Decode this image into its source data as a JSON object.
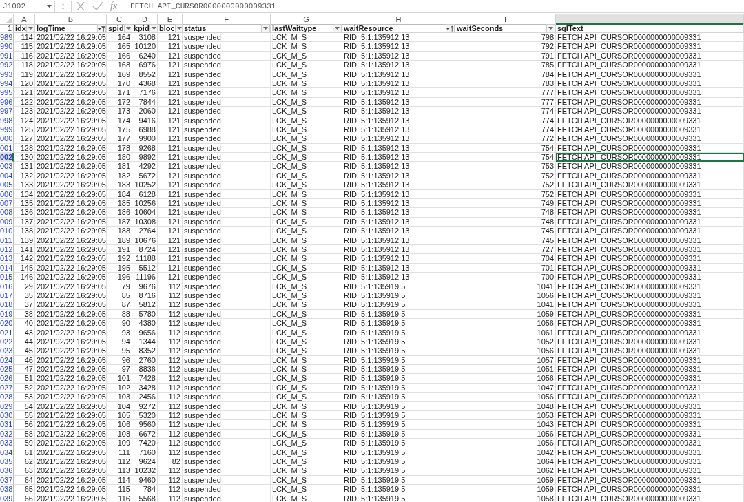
{
  "formula_bar": {
    "name_box": "J1002",
    "function_label": "fx",
    "formula": "FETCH API_CURSOR0000000000009331"
  },
  "column_letters": [
    {
      "letter": "A",
      "selected": false
    },
    {
      "letter": "B",
      "selected": false
    },
    {
      "letter": "C",
      "selected": false
    },
    {
      "letter": "D",
      "selected": false
    },
    {
      "letter": "E",
      "selected": false
    },
    {
      "letter": "F",
      "selected": false
    },
    {
      "letter": "G",
      "selected": false
    },
    {
      "letter": "H",
      "selected": false
    },
    {
      "letter": "I",
      "selected": false
    },
    {
      "selected": true
    }
  ],
  "header_row": {
    "num": "1",
    "columns": [
      {
        "label": "idx",
        "kind": "dropdown",
        "numeric": true
      },
      {
        "label": "logTime",
        "kind": "filtered"
      },
      {
        "label": "spid",
        "kind": "dropdown",
        "numeric": true
      },
      {
        "label": "kpid",
        "kind": "dropdown",
        "numeric": true
      },
      {
        "label": "bloc",
        "kind": "dropdown",
        "numeric": true
      },
      {
        "label": "status",
        "kind": "dropdown",
        "numeric": false
      },
      {
        "label": "lastWaittype",
        "kind": "dropdown",
        "numeric": false
      },
      {
        "label": "waitResource",
        "kind": "sorted",
        "numeric": false
      },
      {
        "label": "waitSeconds",
        "kind": "dropdown",
        "numeric": true
      },
      {
        "label": "sqlText",
        "numeric": false
      }
    ]
  },
  "rows": [
    {
      "num": "989",
      "selected": false,
      "cells": [
        "114",
        "2021/02/22 16:29:05",
        "164",
        "3108",
        "121",
        "suspended",
        "LCK_M_S",
        "RID: 5:1:135912:13",
        "798",
        "FETCH API_CURSOR0000000000009331"
      ]
    },
    {
      "num": "990",
      "selected": false,
      "cells": [
        "115",
        "2021/02/22 16:29:05",
        "165",
        "10120",
        "121",
        "suspended",
        "LCK_M_S",
        "RID: 5:1:135912:13",
        "792",
        "FETCH API_CURSOR0000000000009331"
      ]
    },
    {
      "num": "991",
      "selected": false,
      "cells": [
        "116",
        "2021/02/22 16:29:05",
        "166",
        "6240",
        "121",
        "suspended",
        "LCK_M_S",
        "RID: 5:1:135912:13",
        "791",
        "FETCH API_CURSOR0000000000009331"
      ]
    },
    {
      "num": "992",
      "selected": false,
      "cells": [
        "118",
        "2021/02/22 16:29:05",
        "168",
        "6976",
        "121",
        "suspended",
        "LCK_M_S",
        "RID: 5:1:135912:13",
        "785",
        "FETCH API_CURSOR0000000000009331"
      ]
    },
    {
      "num": "993",
      "selected": false,
      "cells": [
        "119",
        "2021/02/22 16:29:05",
        "169",
        "8552",
        "121",
        "suspended",
        "LCK_M_S",
        "RID: 5:1:135912:13",
        "784",
        "FETCH API_CURSOR0000000000009331"
      ]
    },
    {
      "num": "994",
      "selected": false,
      "cells": [
        "120",
        "2021/02/22 16:29:05",
        "170",
        "4368",
        "121",
        "suspended",
        "LCK_M_S",
        "RID: 5:1:135912:13",
        "783",
        "FETCH API_CURSOR0000000000009331"
      ]
    },
    {
      "num": "995",
      "selected": false,
      "cells": [
        "121",
        "2021/02/22 16:29:05",
        "171",
        "7176",
        "121",
        "suspended",
        "LCK_M_S",
        "RID: 5:1:135912:13",
        "777",
        "FETCH API_CURSOR0000000000009331"
      ]
    },
    {
      "num": "996",
      "selected": false,
      "cells": [
        "122",
        "2021/02/22 16:29:05",
        "172",
        "7844",
        "121",
        "suspended",
        "LCK_M_S",
        "RID: 5:1:135912:13",
        "777",
        "FETCH API_CURSOR0000000000009331"
      ]
    },
    {
      "num": "997",
      "selected": false,
      "cells": [
        "123",
        "2021/02/22 16:29:05",
        "173",
        "2060",
        "121",
        "suspended",
        "LCK_M_S",
        "RID: 5:1:135912:13",
        "774",
        "FETCH API_CURSOR0000000000009331"
      ]
    },
    {
      "num": "998",
      "selected": false,
      "cells": [
        "124",
        "2021/02/22 16:29:05",
        "174",
        "9416",
        "121",
        "suspended",
        "LCK_M_S",
        "RID: 5:1:135912:13",
        "774",
        "FETCH API_CURSOR0000000000009331"
      ]
    },
    {
      "num": "999",
      "selected": false,
      "cells": [
        "125",
        "2021/02/22 16:29:05",
        "175",
        "6988",
        "121",
        "suspended",
        "LCK_M_S",
        "RID: 5:1:135912:13",
        "774",
        "FETCH API_CURSOR0000000000009331"
      ]
    },
    {
      "num": "000",
      "selected": false,
      "cells": [
        "127",
        "2021/02/22 16:29:05",
        "177",
        "9900",
        "121",
        "suspended",
        "LCK_M_S",
        "RID: 5:1:135912:13",
        "772",
        "FETCH API_CURSOR0000000000009331"
      ]
    },
    {
      "num": "001",
      "selected": false,
      "cells": [
        "128",
        "2021/02/22 16:29:05",
        "178",
        "9268",
        "121",
        "suspended",
        "LCK_M_S",
        "RID: 5:1:135912:13",
        "754",
        "FETCH API_CURSOR0000000000009331"
      ]
    },
    {
      "num": "002",
      "selected": true,
      "cells": [
        "130",
        "2021/02/22 16:29:05",
        "180",
        "9892",
        "121",
        "suspended",
        "LCK_M_S",
        "RID: 5:1:135912:13",
        "754",
        "FETCH API_CURSOR0000000000009331"
      ]
    },
    {
      "num": "003",
      "selected": false,
      "cells": [
        "131",
        "2021/02/22 16:29:05",
        "181",
        "4292",
        "121",
        "suspended",
        "LCK_M_S",
        "RID: 5:1:135912:13",
        "753",
        "FETCH API_CURSOR0000000000009331"
      ]
    },
    {
      "num": "004",
      "selected": false,
      "cells": [
        "132",
        "2021/02/22 16:29:05",
        "182",
        "5672",
        "121",
        "suspended",
        "LCK_M_S",
        "RID: 5:1:135912:13",
        "752",
        "FETCH API_CURSOR0000000000009331"
      ]
    },
    {
      "num": "005",
      "selected": false,
      "cells": [
        "133",
        "2021/02/22 16:29:05",
        "183",
        "10252",
        "121",
        "suspended",
        "LCK_M_S",
        "RID: 5:1:135912:13",
        "752",
        "FETCH API_CURSOR0000000000009331"
      ]
    },
    {
      "num": "006",
      "selected": false,
      "cells": [
        "134",
        "2021/02/22 16:29:05",
        "184",
        "6128",
        "121",
        "suspended",
        "LCK_M_S",
        "RID: 5:1:135912:13",
        "752",
        "FETCH API_CURSOR0000000000009331"
      ]
    },
    {
      "num": "007",
      "selected": false,
      "cells": [
        "135",
        "2021/02/22 16:29:05",
        "185",
        "10256",
        "121",
        "suspended",
        "LCK_M_S",
        "RID: 5:1:135912:13",
        "749",
        "FETCH API_CURSOR0000000000009331"
      ]
    },
    {
      "num": "008",
      "selected": false,
      "cells": [
        "136",
        "2021/02/22 16:29:05",
        "186",
        "10604",
        "121",
        "suspended",
        "LCK_M_S",
        "RID: 5:1:135912:13",
        "748",
        "FETCH API_CURSOR0000000000009331"
      ]
    },
    {
      "num": "009",
      "selected": false,
      "cells": [
        "137",
        "2021/02/22 16:29:05",
        "187",
        "10308",
        "121",
        "suspended",
        "LCK_M_S",
        "RID: 5:1:135912:13",
        "748",
        "FETCH API_CURSOR0000000000009331"
      ]
    },
    {
      "num": "010",
      "selected": false,
      "cells": [
        "138",
        "2021/02/22 16:29:05",
        "188",
        "2764",
        "121",
        "suspended",
        "LCK_M_S",
        "RID: 5:1:135912:13",
        "745",
        "FETCH API_CURSOR0000000000009331"
      ]
    },
    {
      "num": "011",
      "selected": false,
      "cells": [
        "139",
        "2021/02/22 16:29:05",
        "189",
        "10676",
        "121",
        "suspended",
        "LCK_M_S",
        "RID: 5:1:135912:13",
        "745",
        "FETCH API_CURSOR0000000000009331"
      ]
    },
    {
      "num": "012",
      "selected": false,
      "cells": [
        "141",
        "2021/02/22 16:29:05",
        "191",
        "8724",
        "121",
        "suspended",
        "LCK_M_S",
        "RID: 5:1:135912:13",
        "727",
        "FETCH API_CURSOR0000000000009331"
      ]
    },
    {
      "num": "013",
      "selected": false,
      "cells": [
        "142",
        "2021/02/22 16:29:05",
        "192",
        "11188",
        "121",
        "suspended",
        "LCK_M_S",
        "RID: 5:1:135912:13",
        "704",
        "FETCH API_CURSOR0000000000009331"
      ]
    },
    {
      "num": "014",
      "selected": false,
      "cells": [
        "145",
        "2021/02/22 16:29:05",
        "195",
        "5512",
        "121",
        "suspended",
        "LCK_M_S",
        "RID: 5:1:135912:13",
        "701",
        "FETCH API_CURSOR0000000000009331"
      ]
    },
    {
      "num": "015",
      "selected": false,
      "cells": [
        "146",
        "2021/02/22 16:29:05",
        "196",
        "11196",
        "121",
        "suspended",
        "LCK_M_S",
        "RID: 5:1:135912:13",
        "700",
        "FETCH API_CURSOR0000000000009331"
      ]
    },
    {
      "num": "016",
      "selected": false,
      "cells": [
        "29",
        "2021/02/22 16:29:05",
        "79",
        "9676",
        "112",
        "suspended",
        "LCK_M_S",
        "RID: 5:1:135919:5",
        "1041",
        "FETCH API_CURSOR0000000000009331"
      ]
    },
    {
      "num": "017",
      "selected": false,
      "cells": [
        "35",
        "2021/02/22 16:29:05",
        "85",
        "8716",
        "112",
        "suspended",
        "LCK_M_S",
        "RID: 5:1:135919:5",
        "1056",
        "FETCH API_CURSOR0000000000009331"
      ]
    },
    {
      "num": "018",
      "selected": false,
      "cells": [
        "37",
        "2021/02/22 16:29:05",
        "87",
        "5812",
        "112",
        "suspended",
        "LCK_M_S",
        "RID: 5:1:135919:5",
        "1041",
        "FETCH API_CURSOR0000000000009331"
      ]
    },
    {
      "num": "019",
      "selected": false,
      "cells": [
        "38",
        "2021/02/22 16:29:05",
        "88",
        "5780",
        "112",
        "suspended",
        "LCK_M_S",
        "RID: 5:1:135919:5",
        "1059",
        "FETCH API_CURSOR0000000000009331"
      ]
    },
    {
      "num": "020",
      "selected": false,
      "cells": [
        "40",
        "2021/02/22 16:29:05",
        "90",
        "4380",
        "112",
        "suspended",
        "LCK_M_S",
        "RID: 5:1:135919:5",
        "1056",
        "FETCH API_CURSOR0000000000009331"
      ]
    },
    {
      "num": "021",
      "selected": false,
      "cells": [
        "43",
        "2021/02/22 16:29:05",
        "93",
        "9656",
        "112",
        "suspended",
        "LCK_M_S",
        "RID: 5:1:135919:5",
        "1061",
        "FETCH API_CURSOR0000000000009331"
      ]
    },
    {
      "num": "022",
      "selected": false,
      "cells": [
        "44",
        "2021/02/22 16:29:05",
        "94",
        "1344",
        "112",
        "suspended",
        "LCK_M_S",
        "RID: 5:1:135919:5",
        "1052",
        "FETCH API_CURSOR0000000000009331"
      ]
    },
    {
      "num": "023",
      "selected": false,
      "cells": [
        "45",
        "2021/02/22 16:29:05",
        "95",
        "8352",
        "112",
        "suspended",
        "LCK_M_S",
        "RID: 5:1:135919:5",
        "1056",
        "FETCH API_CURSOR0000000000009331"
      ]
    },
    {
      "num": "024",
      "selected": false,
      "cells": [
        "46",
        "2021/02/22 16:29:05",
        "96",
        "2760",
        "112",
        "suspended",
        "LCK_M_S",
        "RID: 5:1:135919:5",
        "1057",
        "FETCH API_CURSOR0000000000009331"
      ]
    },
    {
      "num": "025",
      "selected": false,
      "cells": [
        "47",
        "2021/02/22 16:29:05",
        "97",
        "8836",
        "112",
        "suspended",
        "LCK_M_S",
        "RID: 5:1:135919:5",
        "1051",
        "FETCH API_CURSOR0000000000009331"
      ]
    },
    {
      "num": "026",
      "selected": false,
      "cells": [
        "51",
        "2021/02/22 16:29:05",
        "101",
        "7428",
        "112",
        "suspended",
        "LCK_M_S",
        "RID: 5:1:135919:5",
        "1056",
        "FETCH API_CURSOR0000000000009331"
      ]
    },
    {
      "num": "027",
      "selected": false,
      "cells": [
        "52",
        "2021/02/22 16:29:05",
        "102",
        "3428",
        "112",
        "suspended",
        "LCK_M_S",
        "RID: 5:1:135919:5",
        "1047",
        "FETCH API_CURSOR0000000000009331"
      ]
    },
    {
      "num": "028",
      "selected": false,
      "cells": [
        "53",
        "2021/02/22 16:29:05",
        "103",
        "2456",
        "112",
        "suspended",
        "LCK_M_S",
        "RID: 5:1:135919:5",
        "1056",
        "FETCH API_CURSOR0000000000009331"
      ]
    },
    {
      "num": "029",
      "selected": false,
      "cells": [
        "54",
        "2021/02/22 16:29:05",
        "104",
        "9272",
        "112",
        "suspended",
        "LCK_M_S",
        "RID: 5:1:135919:5",
        "1048",
        "FETCH API_CURSOR0000000000009331"
      ]
    },
    {
      "num": "030",
      "selected": false,
      "cells": [
        "55",
        "2021/02/22 16:29:05",
        "105",
        "5320",
        "112",
        "suspended",
        "LCK_M_S",
        "RID: 5:1:135919:5",
        "1053",
        "FETCH API_CURSOR0000000000009331"
      ]
    },
    {
      "num": "031",
      "selected": false,
      "cells": [
        "56",
        "2021/02/22 16:29:05",
        "106",
        "9560",
        "112",
        "suspended",
        "LCK_M_S",
        "RID: 5:1:135919:5",
        "1043",
        "FETCH API_CURSOR0000000000009331"
      ]
    },
    {
      "num": "032",
      "selected": false,
      "cells": [
        "58",
        "2021/02/22 16:29:05",
        "108",
        "6672",
        "112",
        "suspended",
        "LCK_M_S",
        "RID: 5:1:135919:5",
        "1056",
        "FETCH API_CURSOR0000000000009331"
      ]
    },
    {
      "num": "033",
      "selected": false,
      "cells": [
        "59",
        "2021/02/22 16:29:05",
        "109",
        "7420",
        "112",
        "suspended",
        "LCK_M_S",
        "RID: 5:1:135919:5",
        "1056",
        "FETCH API_CURSOR0000000000009331"
      ]
    },
    {
      "num": "034",
      "selected": false,
      "cells": [
        "61",
        "2021/02/22 16:29:05",
        "111",
        "7160",
        "112",
        "suspended",
        "LCK_M_S",
        "RID: 5:1:135919:5",
        "1042",
        "FETCH API_CURSOR0000000000009331"
      ]
    },
    {
      "num": "035",
      "selected": false,
      "cells": [
        "62",
        "2021/02/22 16:29:05",
        "112",
        "9624",
        "82",
        "suspended",
        "LCK_M_S",
        "RID: 5:1:135919:5",
        "1064",
        "FETCH API_CURSOR0000000000009331"
      ]
    },
    {
      "num": "036",
      "selected": false,
      "cells": [
        "63",
        "2021/02/22 16:29:05",
        "113",
        "10232",
        "112",
        "suspended",
        "LCK_M_S",
        "RID: 5:1:135919:5",
        "1062",
        "FETCH API_CURSOR0000000000009331"
      ]
    },
    {
      "num": "037",
      "selected": false,
      "cells": [
        "64",
        "2021/02/22 16:29:05",
        "114",
        "9460",
        "112",
        "suspended",
        "LCK_M_S",
        "RID: 5:1:135919:5",
        "1059",
        "FETCH API_CURSOR0000000000009331"
      ]
    },
    {
      "num": "038",
      "selected": false,
      "cells": [
        "65",
        "2021/02/22 16:29:05",
        "115",
        "784",
        "112",
        "suspended",
        "LCK_M_S",
        "RID: 5:1:135919:5",
        "1059",
        "FETCH API_CURSOR0000000000009331"
      ]
    },
    {
      "num": "039",
      "selected": false,
      "cells": [
        "66",
        "2021/02/22 16:29:05",
        "116",
        "5568",
        "112",
        "suspended",
        "LCK_M_S",
        "RID: 5:1:135919:5",
        "1058",
        "FETCH API_CURSOR0000000000009331"
      ]
    }
  ]
}
